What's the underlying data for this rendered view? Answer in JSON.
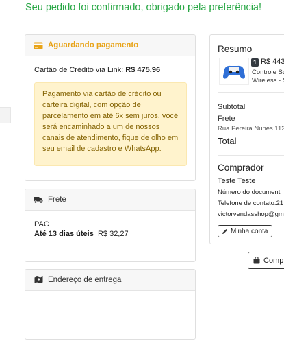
{
  "confirmation": {
    "headline": "Seu pedido foi confirmado, obrigado pela preferência!"
  },
  "payment": {
    "status": "Aguardando pagamento",
    "method_prefix": "Cartão de Crédito via Link:",
    "amount": "R$ 475,96",
    "notice": "Pagamento via cartão de crédito ou carteira digital, com opção de parcelamento em até 6x sem juros, você será encaminhado a um de nossos canais de atendimento, fique de olho em seu email de cadastro e WhatsApp."
  },
  "shipping": {
    "title": "Frete",
    "method": "PAC",
    "eta": "Até 13 dias úteis",
    "cost": "R$ 32,27"
  },
  "address": {
    "title": "Endereço de entrega"
  },
  "summary": {
    "title": "Resumo",
    "item": {
      "quantity": "1",
      "price": "R$ 443,",
      "name_line1": "Controle Sc",
      "name_line2": "Wireless - S"
    },
    "subtotal_label": "Subtotal",
    "frete_label": "Frete",
    "address_line": "Rua Pereira Nunes 112",
    "total_label": "Total"
  },
  "buyer": {
    "title": "Comprador",
    "name": "Teste Teste",
    "document_label": "Número do document",
    "phone_label": "Telefone de contato:21",
    "email": "victorvendasshop@gm",
    "account_button": "Minha conta"
  },
  "actions": {
    "buy_button": "Comp"
  },
  "colors": {
    "success": "#28a745",
    "warning_text": "#856404",
    "warning_bg": "#fff3cd",
    "pending": "#e8a317"
  },
  "icons": {
    "payment": "credit-card-icon",
    "shipping": "truck-icon",
    "address": "map-marker-icon",
    "account": "pen-icon",
    "buy": "shopping-bag-icon"
  }
}
